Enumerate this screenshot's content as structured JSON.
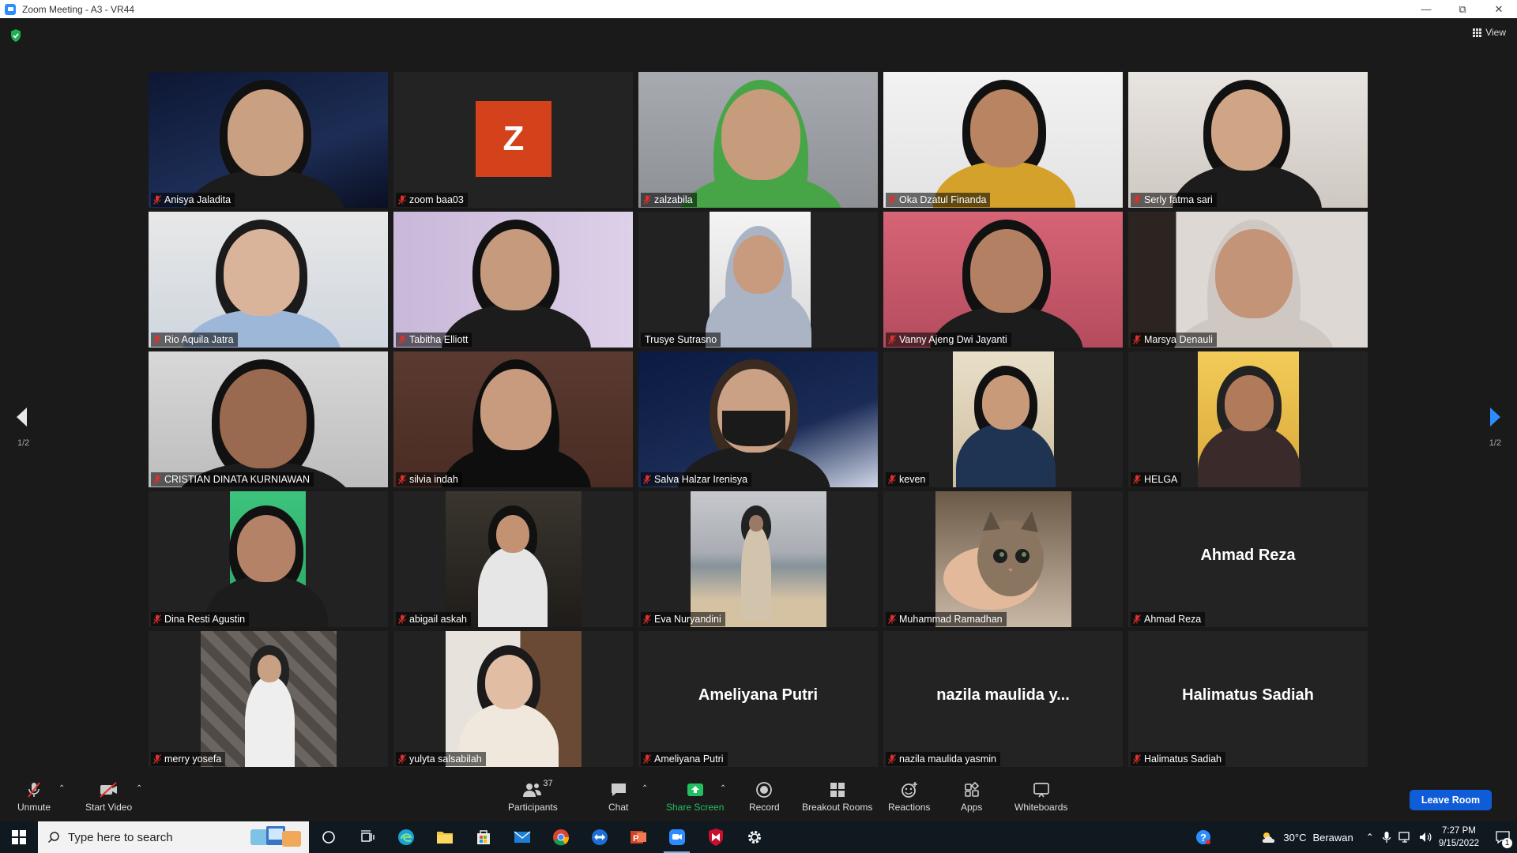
{
  "window": {
    "title": "Zoom Meeting - A3 - VR44"
  },
  "header": {
    "view_label": "View"
  },
  "pagination": {
    "left": "1/2",
    "right": "1/2"
  },
  "participants": [
    {
      "name": "Anisya Jaladita",
      "muted": true,
      "kind": "video"
    },
    {
      "name": "zoom baa03",
      "muted": true,
      "kind": "avatar",
      "initial": "Z"
    },
    {
      "name": "zalzabila",
      "muted": true,
      "kind": "video"
    },
    {
      "name": "Oka Dzatul Finanda",
      "muted": true,
      "kind": "video"
    },
    {
      "name": "Serly fatma sari",
      "muted": true,
      "kind": "video"
    },
    {
      "name": "Rio Aquila Jatra",
      "muted": true,
      "kind": "video"
    },
    {
      "name": "Tabitha Elliott",
      "muted": true,
      "kind": "video"
    },
    {
      "name": "Trusye Sutrasno",
      "muted": false,
      "kind": "video",
      "active_speaker": true
    },
    {
      "name": "Vanny Ajeng Dwi Jayanti",
      "muted": true,
      "kind": "video"
    },
    {
      "name": "Marsya Denauli",
      "muted": true,
      "kind": "video"
    },
    {
      "name": "CRISTIAN DINATA KURNIAWAN",
      "muted": true,
      "kind": "video"
    },
    {
      "name": "silvia indah",
      "muted": true,
      "kind": "video"
    },
    {
      "name": "Salva Halzar Irenisya",
      "muted": true,
      "kind": "video"
    },
    {
      "name": "keven",
      "muted": true,
      "kind": "video"
    },
    {
      "name": "HELGA",
      "muted": true,
      "kind": "video"
    },
    {
      "name": "Dina Resti Agustin",
      "muted": true,
      "kind": "video"
    },
    {
      "name": "abigail askah",
      "muted": true,
      "kind": "video"
    },
    {
      "name": "Eva Nuryandini",
      "muted": true,
      "kind": "video"
    },
    {
      "name": "Muhammad Ramadhan",
      "muted": true,
      "kind": "video"
    },
    {
      "name": "Ahmad Reza",
      "muted": true,
      "kind": "name-only",
      "display_name": "Ahmad Reza"
    },
    {
      "name": "merry yosefa",
      "muted": true,
      "kind": "video"
    },
    {
      "name": "yulyta salsabilah",
      "muted": true,
      "kind": "video"
    },
    {
      "name": "Ameliyana Putri",
      "muted": true,
      "kind": "name-only",
      "display_name": "Ameliyana Putri"
    },
    {
      "name": "nazila maulida yasmin",
      "muted": true,
      "kind": "name-only",
      "display_name": "nazila maulida y..."
    },
    {
      "name": "Halimatus Sadiah",
      "muted": true,
      "kind": "name-only",
      "display_name": "Halimatus Sadiah"
    }
  ],
  "toolbar": {
    "unmute": "Unmute",
    "start_video": "Start Video",
    "participants": "Participants",
    "participants_count": "37",
    "chat": "Chat",
    "share_screen": "Share Screen",
    "record": "Record",
    "breakout_rooms": "Breakout Rooms",
    "reactions": "Reactions",
    "apps": "Apps",
    "whiteboards": "Whiteboards",
    "leave_room": "Leave Room"
  },
  "taskbar": {
    "search_placeholder": "Type here to search",
    "weather_temp": "30°C",
    "weather_text": "Berawan",
    "time": "7:27 PM",
    "date": "9/15/2022",
    "notification_count": "1"
  },
  "colors": {
    "accent_blue": "#0e5cd8",
    "active_speaker": "#e6e87a",
    "muted_red": "#e0302a",
    "share_green": "#20c060",
    "avatar_bg": "#d4421c"
  }
}
